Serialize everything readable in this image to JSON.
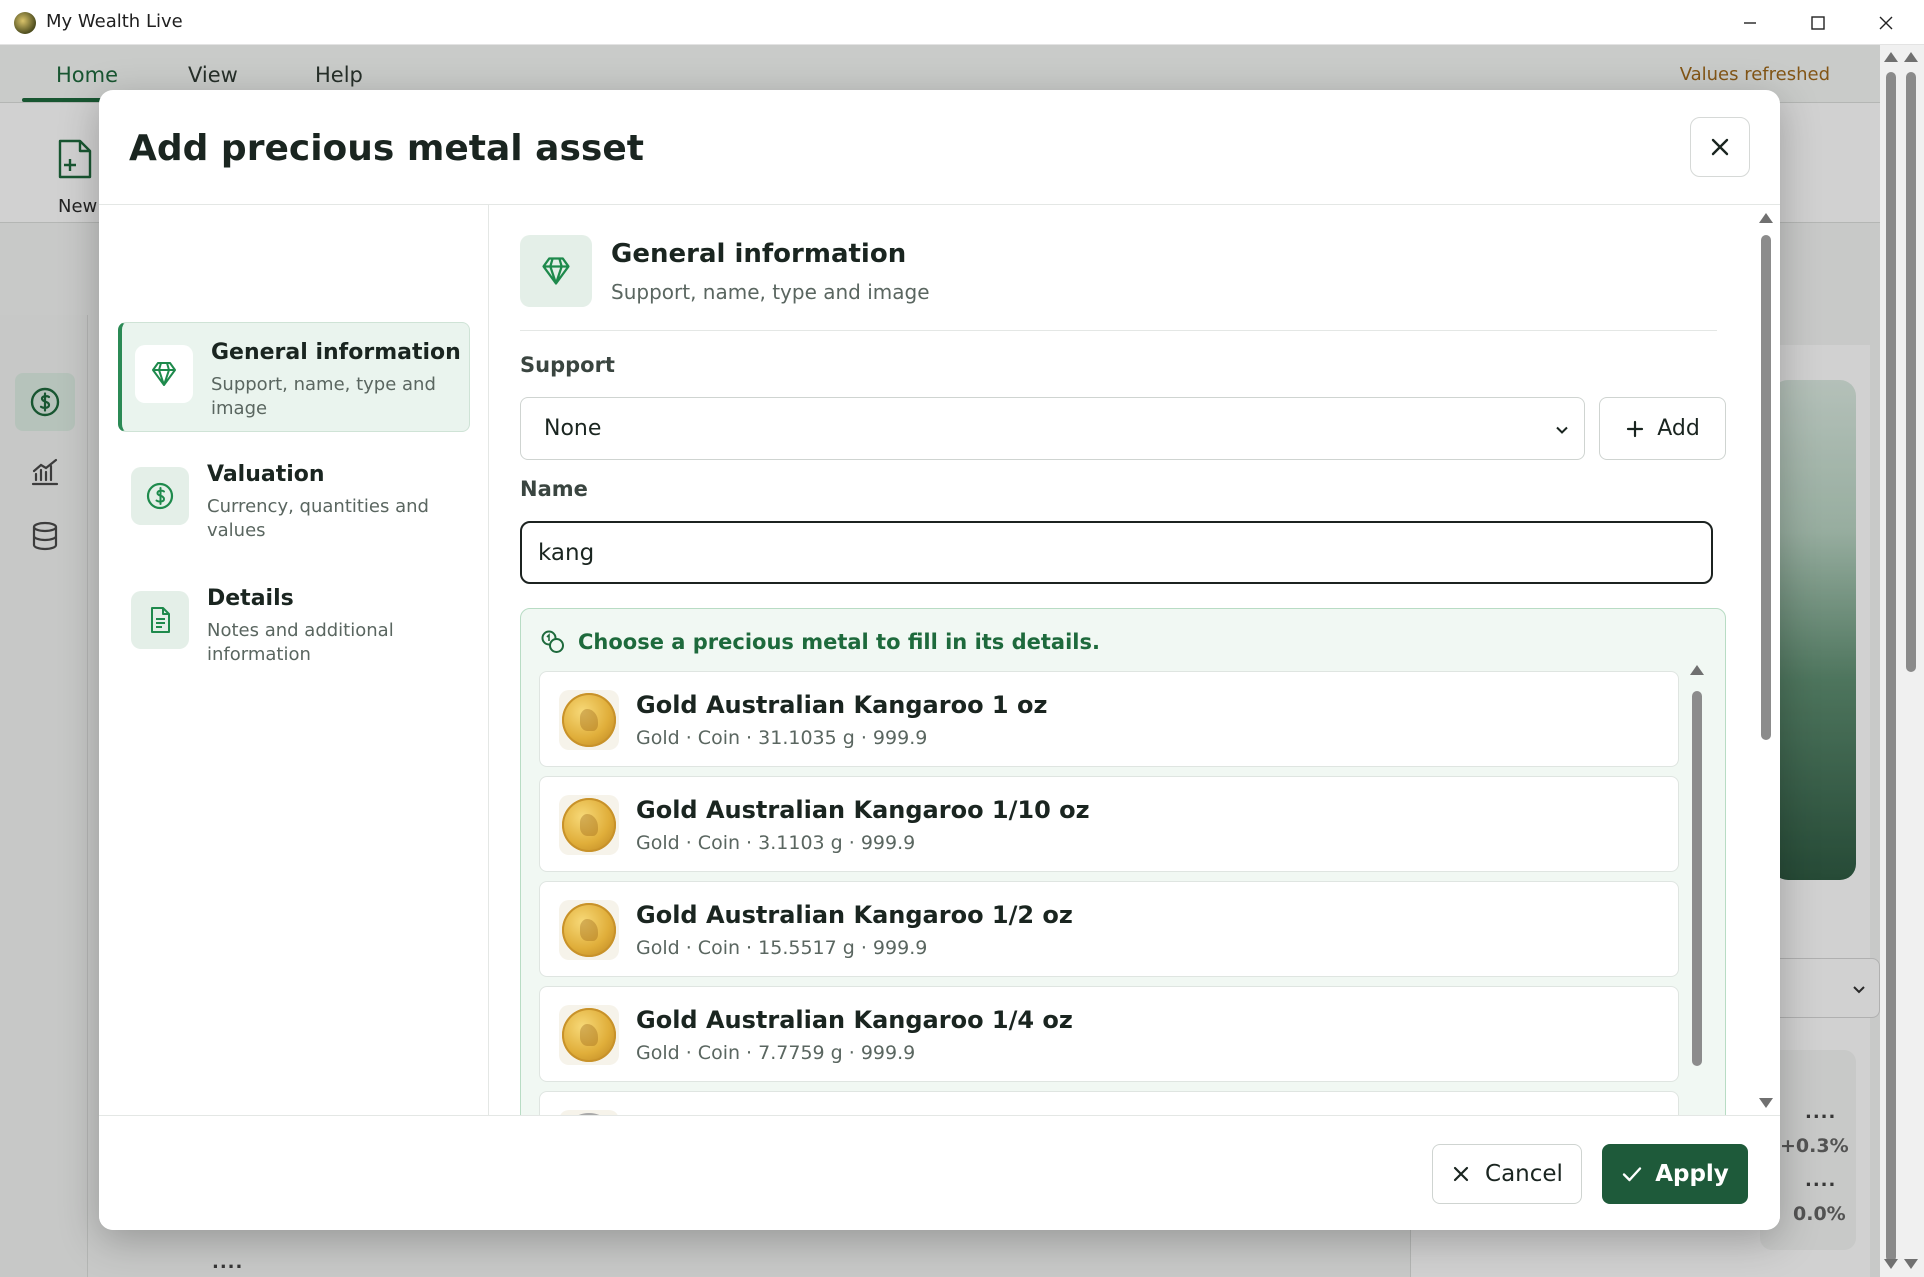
{
  "window": {
    "title": "My Wealth Live"
  },
  "background": {
    "tabs": [
      "Home",
      "View",
      "Help"
    ],
    "status": "Values refreshed",
    "new_label": "New",
    "dots_1": "....",
    "pct_1": "+0.3%",
    "dots_2": "....",
    "pct_2": "0.0%",
    "dots_3": "...."
  },
  "dialog": {
    "title": "Add precious metal asset",
    "steps": [
      {
        "title": "General information",
        "subtitle": "Support, name, type and image",
        "icon": "diamond-icon",
        "active": true
      },
      {
        "title": "Valuation",
        "subtitle": "Currency, quantities and values",
        "icon": "dollar-circle-icon",
        "active": false
      },
      {
        "title": "Details",
        "subtitle": "Notes and additional information",
        "icon": "document-icon",
        "active": false
      }
    ],
    "section": {
      "title": "General information",
      "subtitle": "Support, name, type and image"
    },
    "support": {
      "label": "Support",
      "value": "None",
      "add_label": "Add"
    },
    "name": {
      "label": "Name",
      "value": "kang"
    },
    "suggestions": {
      "header": "Choose a precious metal to fill in its details.",
      "items": [
        {
          "title": "Gold Australian Kangaroo 1 oz",
          "subtitle": "Gold · Coin · 31.1035 g · 999.9"
        },
        {
          "title": "Gold Australian Kangaroo 1/10 oz",
          "subtitle": "Gold · Coin · 3.1103 g · 999.9"
        },
        {
          "title": "Gold Australian Kangaroo 1/2 oz",
          "subtitle": "Gold · Coin · 15.5517 g · 999.9"
        },
        {
          "title": "Gold Australian Kangaroo 1/4 oz",
          "subtitle": "Gold · Coin · 7.7759 g · 999.9"
        }
      ]
    },
    "footer": {
      "cancel_label": "Cancel",
      "apply_label": "Apply"
    }
  },
  "colors": {
    "accent": "#1e5a3a",
    "accent_light": "#eaf4ee",
    "status": "#a06a1c"
  }
}
